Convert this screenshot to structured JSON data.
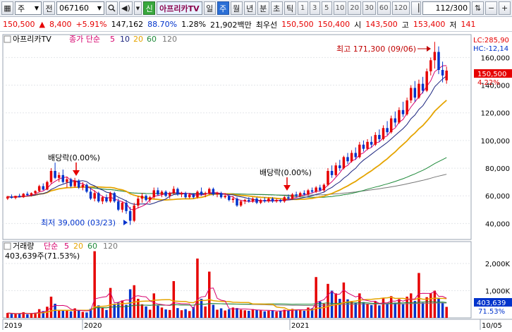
{
  "toolbar": {
    "market": "주",
    "prev_label": "전",
    "code": "067160",
    "sin_label": "신",
    "stock_name": "아프리카TV",
    "periods": [
      "일",
      "주",
      "월",
      "년",
      "분",
      "초",
      "틱"
    ],
    "selected_period": "주",
    "nums": [
      "1",
      "3",
      "5",
      "10",
      "20",
      "30",
      "60",
      "120"
    ],
    "count": "112",
    "count_total": "/300"
  },
  "quote": {
    "price": "150,500",
    "change": "8,400",
    "change_pct": "+5.91%",
    "volume": "147,162",
    "vol_ratio": "88.70%",
    "turnover": "1.28%",
    "amount": "21,902백만",
    "priority_label": "최우선",
    "ask": "150,500",
    "bid": "150,400",
    "low_label": "시",
    "open": "143,500",
    "high_label": "고",
    "high": "153,400",
    "lo2_label": "저",
    "low": "141"
  },
  "price_panel": {
    "title": "아프리카TV",
    "ma_label": "종가 단순",
    "ma_periods": [
      "5",
      "10",
      "20",
      "60",
      "120"
    ],
    "lc": "LC:285,90",
    "hc": "HC:-12,14",
    "current": "150,500",
    "current_pct": "4.22%",
    "high_note": "최고 171,300 (09/06)",
    "low_note": "최저 39,000 (03/23)",
    "div1": "배당락(0.00%)",
    "div2": "배당락(0.00%)",
    "y_ticks": [
      "160,000",
      "140,000",
      "120,000",
      "100,000",
      "80,000",
      "60,000",
      "40,000"
    ]
  },
  "volume_panel": {
    "title": "거래량",
    "ma_label": "단순",
    "ma_periods": [
      "5",
      "20",
      "60",
      "120"
    ],
    "last_vol": "403,639주(71.53%)",
    "current": "403,639",
    "current_pct": "71.53%",
    "y_ticks": [
      "2,000K",
      "1,000K"
    ]
  },
  "x_axis": [
    "2019",
    "2020",
    "2021",
    "10/05"
  ],
  "colors": {
    "up": "#e60000",
    "down": "#0033cc",
    "ma5": "#d6006d",
    "ma10": "#1a237e",
    "ma20": "#e5a400",
    "ma60": "#1f8a3a",
    "ma120": "#777777"
  },
  "chart_data": {
    "type": "candlestick",
    "price_ylim": [
      30000,
      175000
    ],
    "volume_ylim": [
      0,
      2700
    ],
    "volume_unit": "K",
    "candles": [
      [
        58000,
        60000,
        57000,
        59500,
        180
      ],
      [
        59500,
        61000,
        58000,
        58500,
        150
      ],
      [
        58500,
        60000,
        57500,
        60000,
        140
      ],
      [
        60000,
        61500,
        59000,
        59000,
        160
      ],
      [
        59000,
        62000,
        58500,
        61500,
        210
      ],
      [
        61500,
        63000,
        60000,
        60500,
        130
      ],
      [
        60500,
        62500,
        59500,
        62000,
        170
      ],
      [
        62000,
        64000,
        61000,
        63500,
        190
      ],
      [
        63500,
        68000,
        62500,
        67000,
        320
      ],
      [
        67000,
        69000,
        64000,
        64500,
        250
      ],
      [
        64500,
        71000,
        64000,
        70000,
        410
      ],
      [
        70000,
        80000,
        69000,
        78000,
        780
      ],
      [
        78000,
        84000,
        72000,
        73000,
        520
      ],
      [
        73000,
        77000,
        70000,
        75000,
        300
      ],
      [
        75000,
        79000,
        69000,
        70000,
        280
      ],
      [
        70000,
        74000,
        66000,
        72000,
        260
      ],
      [
        72000,
        73000,
        66000,
        67000,
        240
      ],
      [
        67000,
        73000,
        66000,
        71000,
        350
      ],
      [
        71000,
        72000,
        65000,
        66000,
        270
      ],
      [
        66000,
        70000,
        64000,
        68000,
        220
      ],
      [
        68000,
        69000,
        62000,
        63000,
        200
      ],
      [
        63000,
        66000,
        57000,
        58000,
        330
      ],
      [
        58000,
        64000,
        56000,
        62000,
        2450
      ],
      [
        62000,
        63000,
        55000,
        56000,
        460
      ],
      [
        56000,
        60000,
        54000,
        59000,
        380
      ],
      [
        59000,
        61000,
        55000,
        56000,
        290
      ],
      [
        56000,
        63000,
        55000,
        62000,
        1100
      ],
      [
        62000,
        63000,
        55000,
        56000,
        520
      ],
      [
        56000,
        58000,
        49000,
        50000,
        560
      ],
      [
        50000,
        56000,
        48000,
        55000,
        640
      ],
      [
        55000,
        57000,
        47000,
        49000,
        480
      ],
      [
        49000,
        52000,
        39000,
        42000,
        1050
      ],
      [
        42000,
        55000,
        41000,
        53000,
        1200
      ],
      [
        53000,
        60000,
        51000,
        58000,
        700
      ],
      [
        58000,
        62000,
        55000,
        60000,
        500
      ],
      [
        60000,
        61000,
        56000,
        57000,
        420
      ],
      [
        57000,
        60000,
        55000,
        59000,
        300
      ],
      [
        59000,
        66000,
        58000,
        64000,
        900
      ],
      [
        64000,
        66000,
        60000,
        61000,
        450
      ],
      [
        61000,
        64000,
        59000,
        63000,
        380
      ],
      [
        63000,
        64000,
        59000,
        60000,
        310
      ],
      [
        60000,
        63000,
        58000,
        62000,
        290
      ],
      [
        62000,
        67000,
        61000,
        65000,
        1350
      ],
      [
        65000,
        66000,
        60000,
        61000,
        360
      ],
      [
        61000,
        63000,
        59000,
        62000,
        280
      ],
      [
        62000,
        63000,
        58000,
        59000,
        320
      ],
      [
        59000,
        62000,
        58000,
        61000,
        250
      ],
      [
        61000,
        62000,
        58000,
        59000,
        400
      ],
      [
        59000,
        64000,
        58000,
        63000,
        2180
      ],
      [
        63000,
        66000,
        60000,
        61000,
        700
      ],
      [
        61000,
        63000,
        59000,
        62000,
        420
      ],
      [
        62000,
        66000,
        61000,
        65000,
        1700
      ],
      [
        65000,
        66000,
        60000,
        61000,
        480
      ],
      [
        61000,
        63000,
        59000,
        62000,
        300
      ],
      [
        62000,
        63000,
        58000,
        59000,
        350
      ],
      [
        59000,
        62000,
        58000,
        60000,
        270
      ],
      [
        60000,
        61000,
        56000,
        57000,
        320
      ],
      [
        57000,
        60000,
        55000,
        58000,
        380
      ],
      [
        58000,
        59000,
        52000,
        53000,
        360
      ],
      [
        53000,
        57000,
        52000,
        56000,
        300
      ],
      [
        56000,
        58000,
        54000,
        57000,
        280
      ],
      [
        57000,
        59000,
        55000,
        56000,
        260
      ],
      [
        56000,
        59000,
        55000,
        58000,
        320
      ],
      [
        58000,
        59000,
        54000,
        55000,
        300
      ],
      [
        55000,
        58000,
        54000,
        57000,
        270
      ],
      [
        57000,
        59000,
        55000,
        56000,
        240
      ],
      [
        56000,
        59000,
        55000,
        58000,
        260
      ],
      [
        58000,
        59000,
        55000,
        56000,
        280
      ],
      [
        56000,
        58000,
        55000,
        57000,
        230
      ],
      [
        57000,
        58000,
        55000,
        56000,
        250
      ],
      [
        56000,
        60000,
        55000,
        59000,
        300
      ],
      [
        59000,
        61000,
        57000,
        58000,
        270
      ],
      [
        58000,
        62000,
        57000,
        61000,
        330
      ],
      [
        61000,
        63000,
        59000,
        60000,
        310
      ],
      [
        60000,
        63000,
        59000,
        62000,
        280
      ],
      [
        62000,
        64000,
        60000,
        61000,
        260
      ],
      [
        61000,
        65000,
        60000,
        64000,
        380
      ],
      [
        64000,
        66000,
        62000,
        63000,
        350
      ],
      [
        63000,
        67000,
        62000,
        66000,
        1500
      ],
      [
        66000,
        68000,
        63000,
        64000,
        600
      ],
      [
        64000,
        69000,
        63000,
        68000,
        520
      ],
      [
        68000,
        80000,
        67000,
        78000,
        1250
      ],
      [
        78000,
        82000,
        73000,
        75000,
        1000
      ],
      [
        75000,
        84000,
        74000,
        82000,
        900
      ],
      [
        82000,
        86000,
        78000,
        80000,
        700
      ],
      [
        80000,
        89000,
        79000,
        88000,
        1300
      ],
      [
        88000,
        91000,
        83000,
        85000,
        680
      ],
      [
        85000,
        93000,
        84000,
        91000,
        620
      ],
      [
        91000,
        95000,
        86000,
        88000,
        560
      ],
      [
        88000,
        99000,
        87000,
        97000,
        900
      ],
      [
        97000,
        100000,
        92000,
        94000,
        580
      ],
      [
        94000,
        101000,
        93000,
        99000,
        520
      ],
      [
        99000,
        103000,
        95000,
        97000,
        470
      ],
      [
        97000,
        106000,
        96000,
        104000,
        600
      ],
      [
        104000,
        108000,
        99000,
        101000,
        460
      ],
      [
        101000,
        111000,
        100000,
        109000,
        720
      ],
      [
        109000,
        114000,
        104000,
        106000,
        520
      ],
      [
        106000,
        118000,
        105000,
        116000,
        800
      ],
      [
        116000,
        121000,
        110000,
        113000,
        560
      ],
      [
        113000,
        124000,
        112000,
        122000,
        690
      ],
      [
        122000,
        128000,
        117000,
        119000,
        500
      ],
      [
        119000,
        131000,
        118000,
        129000,
        780
      ],
      [
        129000,
        140000,
        127000,
        138000,
        900
      ],
      [
        138000,
        143000,
        128000,
        131000,
        620
      ],
      [
        131000,
        144000,
        130000,
        141000,
        1650
      ],
      [
        141000,
        146000,
        134000,
        136000,
        560
      ],
      [
        136000,
        152000,
        135000,
        150000,
        760
      ],
      [
        150000,
        160000,
        147000,
        158000,
        900
      ],
      [
        158000,
        171300,
        152000,
        164000,
        1000
      ],
      [
        164000,
        168000,
        148000,
        151000,
        740
      ],
      [
        151000,
        157000,
        142000,
        147000,
        560
      ],
      [
        143500,
        153400,
        141000,
        150500,
        404
      ]
    ],
    "ma20_end": 132000,
    "ma60_end": 89000,
    "ma120_end": 76000
  }
}
